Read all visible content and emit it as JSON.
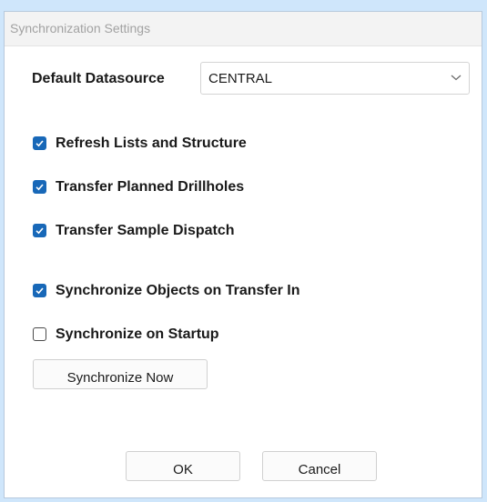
{
  "window": {
    "title": "Synchronization Settings"
  },
  "datasource": {
    "label": "Default Datasource",
    "selected": "CENTRAL"
  },
  "options": [
    {
      "label": "Refresh Lists and Structure",
      "checked": true
    },
    {
      "label": "Transfer Planned Drillholes",
      "checked": true
    },
    {
      "label": "Transfer Sample Dispatch",
      "checked": true
    },
    {
      "label": "Synchronize Objects on Transfer In",
      "checked": true
    },
    {
      "label": "Synchronize on Startup",
      "checked": false
    }
  ],
  "buttons": {
    "sync_now": "Synchronize Now",
    "ok": "OK",
    "cancel": "Cancel"
  },
  "colors": {
    "accent": "#1868b8",
    "background": "#cfe6fb"
  }
}
